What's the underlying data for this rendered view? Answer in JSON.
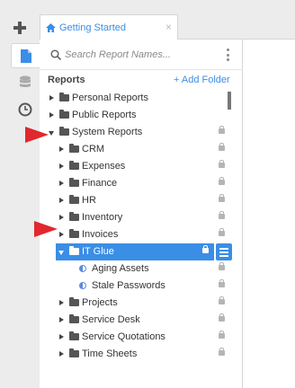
{
  "tabs": [
    {
      "label": "Getting Started"
    }
  ],
  "search": {
    "placeholder": "Search Report Names..."
  },
  "reports": {
    "title": "Reports",
    "add_folder": "+ Add Folder"
  },
  "tree": [
    {
      "label": "Personal Reports",
      "level": 0,
      "kind": "folder",
      "expanded": false,
      "locked": false
    },
    {
      "label": "Public Reports",
      "level": 0,
      "kind": "folder",
      "expanded": false,
      "locked": false
    },
    {
      "label": "System Reports",
      "level": 0,
      "kind": "folder",
      "expanded": true,
      "locked": true
    },
    {
      "label": "CRM",
      "level": 1,
      "kind": "folder",
      "expanded": false,
      "locked": true
    },
    {
      "label": "Expenses",
      "level": 1,
      "kind": "folder",
      "expanded": false,
      "locked": true
    },
    {
      "label": "Finance",
      "level": 1,
      "kind": "folder",
      "expanded": false,
      "locked": true
    },
    {
      "label": "HR",
      "level": 1,
      "kind": "folder",
      "expanded": false,
      "locked": true
    },
    {
      "label": "Inventory",
      "level": 1,
      "kind": "folder",
      "expanded": false,
      "locked": true
    },
    {
      "label": "Invoices",
      "level": 1,
      "kind": "folder",
      "expanded": false,
      "locked": true
    },
    {
      "label": "IT Glue",
      "level": 1,
      "kind": "folder",
      "expanded": true,
      "locked": true,
      "selected": true
    },
    {
      "label": "Aging Assets",
      "level": 2,
      "kind": "report",
      "locked": true
    },
    {
      "label": "Stale Passwords",
      "level": 2,
      "kind": "report",
      "locked": true
    },
    {
      "label": "Projects",
      "level": 1,
      "kind": "folder",
      "expanded": false,
      "locked": true
    },
    {
      "label": "Service Desk",
      "level": 1,
      "kind": "folder",
      "expanded": false,
      "locked": true
    },
    {
      "label": "Service Quotations",
      "level": 1,
      "kind": "folder",
      "expanded": false,
      "locked": true
    },
    {
      "label": "Time Sheets",
      "level": 1,
      "kind": "folder",
      "expanded": false,
      "locked": true
    }
  ],
  "colors": {
    "accent": "#3a8ee6",
    "annotation_arrow": "#e0282e"
  }
}
